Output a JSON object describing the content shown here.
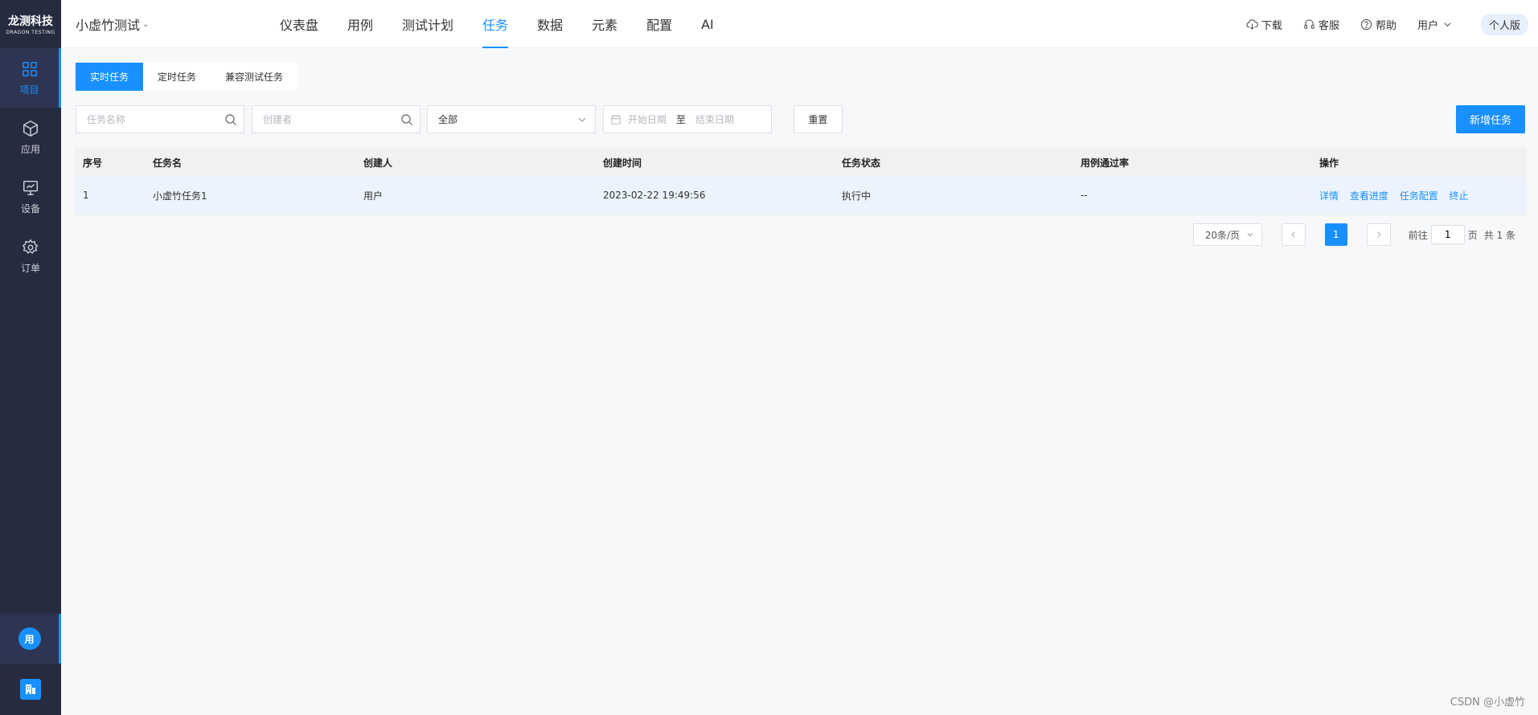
{
  "logo": {
    "line1": "龙测科技",
    "line2": "DRAGON TESTING"
  },
  "sidebar": {
    "items": [
      {
        "label": "项目",
        "icon": "grid-icon",
        "active": true
      },
      {
        "label": "应用",
        "icon": "cube-icon",
        "active": false
      },
      {
        "label": "设备",
        "icon": "monitor-icon",
        "active": false
      },
      {
        "label": "订单",
        "icon": "gear-icon",
        "active": false
      }
    ],
    "avatar": "用",
    "org_icon": "building-icon"
  },
  "header": {
    "project": "小虚竹测试",
    "nav": [
      "仪表盘",
      "用例",
      "测试计划",
      "任务",
      "数据",
      "元素",
      "配置",
      "AI"
    ],
    "active_nav": "任务",
    "download": "下载",
    "service": "客服",
    "help": "帮助",
    "user": "用户",
    "plan": "个人版"
  },
  "tabs": [
    "实时任务",
    "定时任务",
    "兼容测试任务"
  ],
  "filters": {
    "task_name_placeholder": "任务名称",
    "creator_placeholder": "创建者",
    "status_value": "全部",
    "start_date_placeholder": "开始日期",
    "range_sep": "至",
    "end_date_placeholder": "结束日期",
    "reset": "重置",
    "new_task": "新增任务"
  },
  "table": {
    "headers": [
      "序号",
      "任务名",
      "创建人",
      "创建时间",
      "任务状态",
      "用例通过率",
      "操作"
    ],
    "rows": [
      {
        "index": "1",
        "name": "小虚竹任务1",
        "creator": "用户",
        "created": "2023-02-22 19:49:56",
        "status": "执行中",
        "pass_rate": "--",
        "actions": [
          "详情",
          "查看进度",
          "任务配置",
          "终止"
        ]
      }
    ]
  },
  "pagination": {
    "page_size": "20条/页",
    "current": "1",
    "goto_label": "前往",
    "goto_value": "1",
    "page_unit": "页",
    "total": "共 1 条"
  },
  "watermark": "CSDN @小虚竹",
  "colors": {
    "primary": "#1890ff",
    "sidebar": "#272b3f"
  }
}
